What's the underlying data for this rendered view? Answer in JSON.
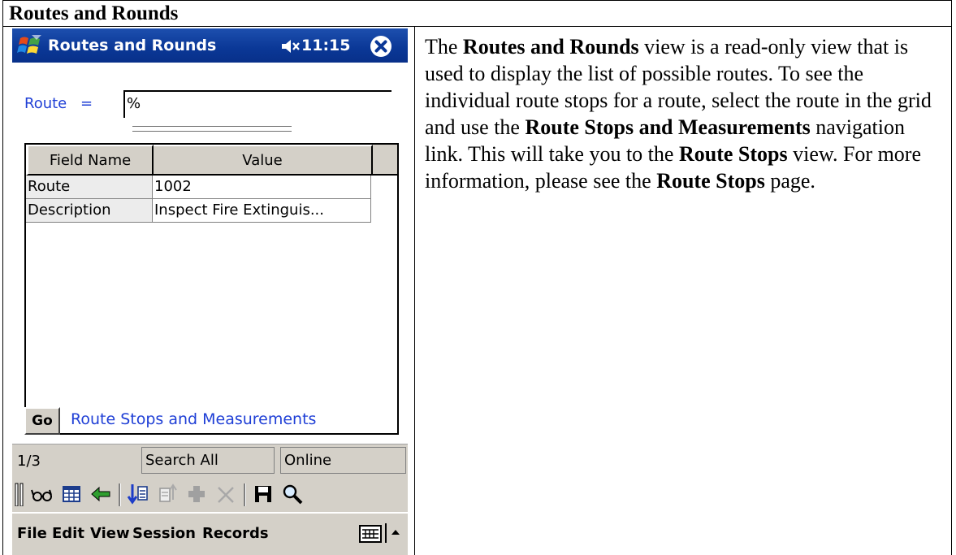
{
  "doc": {
    "title": "Routes and Rounds"
  },
  "device": {
    "app_title": "Routes and Rounds",
    "clock": "11:15",
    "filter": {
      "label": "Route",
      "operator": "=",
      "value": "%"
    },
    "grid": {
      "columns": [
        "Field Name",
        "Value"
      ],
      "rows": [
        {
          "field": "Route",
          "value": "1002"
        },
        {
          "field": "Description",
          "value": "Inspect Fire Extinguis..."
        }
      ]
    },
    "go_button": "Go",
    "nav_link": "Route Stops and Measurements",
    "status": {
      "page": "1/3",
      "search": "Search All",
      "mode": "Online"
    },
    "toolbar_icons": [
      "grip-icon",
      "view-glasses-icon",
      "grid-icon",
      "back-arrow-icon",
      "insert-record-icon",
      "edit-record-icon",
      "add-record-icon",
      "delete-record-icon",
      "save-icon",
      "search-icon"
    ],
    "menu": [
      "File",
      "Edit",
      "View",
      "Session",
      "Records"
    ]
  },
  "description": {
    "p1": "The ",
    "b1": "Routes and Rounds",
    "p2": " view is a read-only view that is used to display the list of possible routes.  To see the individual route stops for a route, select the route in the grid and use the ",
    "b2": "Route Stops and Measurements",
    "p3": " navigation link.  This will take you to the ",
    "b3": "Route Stops",
    "p4": " view.  For more information, please see the ",
    "b4": "Route Stops",
    "p5": " page."
  },
  "colors": {
    "titlebar": "#0a3796",
    "link": "#1f3fd6",
    "chrome": "#d4d0c8"
  }
}
